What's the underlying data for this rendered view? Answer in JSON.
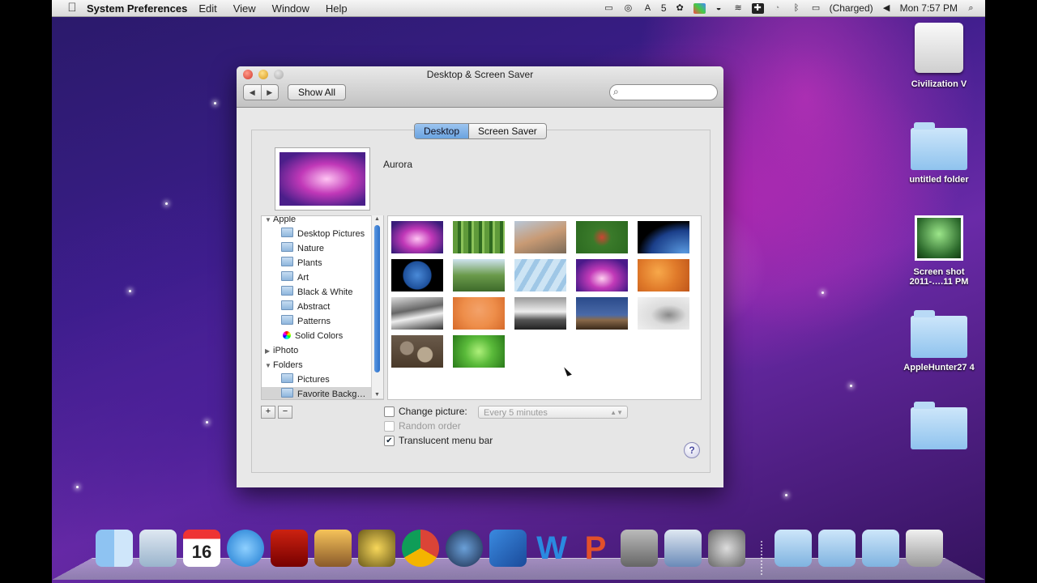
{
  "menubar": {
    "app_name": "System Preferences",
    "items": [
      "Edit",
      "View",
      "Window",
      "Help"
    ],
    "status": {
      "battery": "(Charged)",
      "clock": "Mon 7:57 PM",
      "badge": "5"
    }
  },
  "window": {
    "title": "Desktop & Screen Saver",
    "show_all": "Show All",
    "search_placeholder": "",
    "tabs": [
      "Desktop",
      "Screen Saver"
    ],
    "active_tab": "Desktop",
    "current_picture": "Aurora",
    "sources": [
      {
        "label": "Apple",
        "kind": "group",
        "expanded": true
      },
      {
        "label": "Desktop Pictures",
        "kind": "folder"
      },
      {
        "label": "Nature",
        "kind": "folder"
      },
      {
        "label": "Plants",
        "kind": "folder"
      },
      {
        "label": "Art",
        "kind": "folder"
      },
      {
        "label": "Black & White",
        "kind": "folder"
      },
      {
        "label": "Abstract",
        "kind": "folder"
      },
      {
        "label": "Patterns",
        "kind": "folder"
      },
      {
        "label": "Solid Colors",
        "kind": "colors"
      },
      {
        "label": "iPhoto",
        "kind": "group",
        "expanded": false
      },
      {
        "label": "Folders",
        "kind": "group",
        "expanded": true
      },
      {
        "label": "Pictures",
        "kind": "folder"
      },
      {
        "label": "Favorite Backg…",
        "kind": "folder",
        "selected": true
      }
    ],
    "options": {
      "change_picture": {
        "label": "Change picture:",
        "checked": false
      },
      "interval": "Every 5 minutes",
      "random_order": {
        "label": "Random order",
        "checked": false,
        "enabled": false
      },
      "translucent_menu_bar": {
        "label": "Translucent menu bar",
        "checked": true
      }
    },
    "help": "?"
  },
  "desktop_icons": [
    {
      "label": "Civilization V",
      "kind": "drive"
    },
    {
      "label": "untitled folder",
      "kind": "folder"
    },
    {
      "label": "Screen shot 2011-….11 PM",
      "kind": "screenshot"
    },
    {
      "label": "AppleHunter27 4",
      "kind": "folder"
    },
    {
      "label": "",
      "kind": "folder"
    }
  ],
  "dock_apps": [
    "finder-icon",
    "mail-icon",
    "ical-icon",
    "itunes-icon",
    "photobooth-icon",
    "iphoto-icon",
    "imovie-icon",
    "chrome-icon",
    "facetime-icon",
    "xcode-icon",
    "word-icon",
    "powerpoint-icon",
    "imovie-theater-icon",
    "preview-icon",
    "system-preferences-icon",
    "applications-folder-icon",
    "documents-folder-icon",
    "downloads-folder-icon",
    "trash-icon"
  ]
}
